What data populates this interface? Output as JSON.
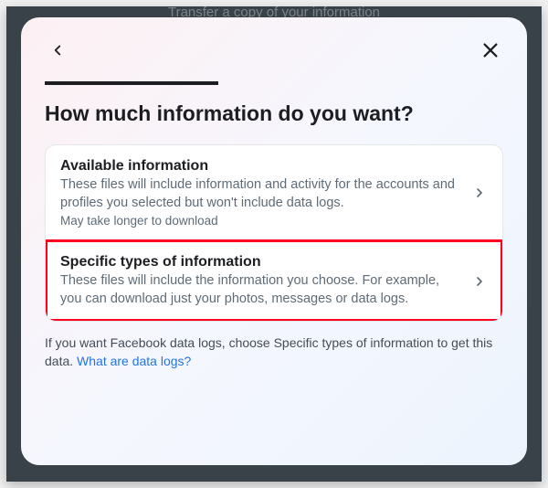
{
  "background": {
    "title_behind": "Transfer a copy of your information"
  },
  "modal": {
    "title": "How much information do you want?",
    "options": [
      {
        "title": "Available information",
        "description": "These files will include information and activity for the accounts and profiles you selected but won't include data logs.",
        "note": "May take longer to download"
      },
      {
        "title": "Specific types of information",
        "description": "These files will include the information you choose. For example, you can download just your photos, messages or data logs."
      }
    ],
    "footer": {
      "text": "If you want Facebook data logs, choose Specific types of information to get this data. ",
      "link": "What are data logs?"
    }
  }
}
